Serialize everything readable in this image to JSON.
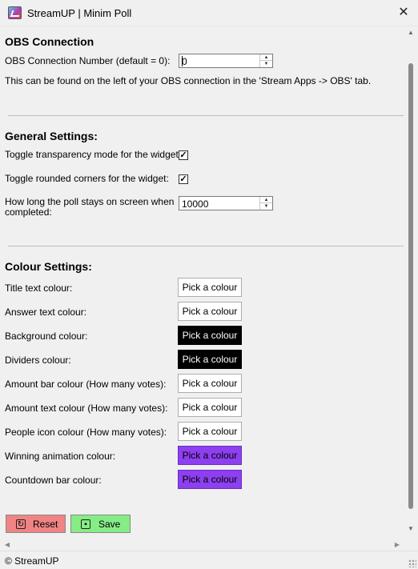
{
  "window": {
    "title": "StreamUP | Minim Poll",
    "close_glyph": "✕",
    "app_icon": "streamup-poll-icon"
  },
  "obs_connection": {
    "heading": "OBS Connection",
    "number_label": "OBS Connection Number (default = 0):",
    "number_value": "0",
    "info": "This can be found on the left of your OBS connection in the 'Stream Apps -> OBS' tab."
  },
  "general_settings": {
    "heading": "General Settings:",
    "transparency_label": "Toggle transparency mode for the widget:",
    "transparency_checked": true,
    "rounded_label": "Toggle rounded corners for the widget:",
    "rounded_checked": true,
    "duration_label_line1": "How long the poll stays on screen when",
    "duration_label_line2": "completed:",
    "duration_value": "10000",
    "check_glyph": "✓"
  },
  "colour_settings": {
    "heading": "Colour Settings:",
    "button_label": "Pick a colour",
    "rows": [
      {
        "label": "Title text colour:",
        "swatch": "#ffffff"
      },
      {
        "label": "Answer text colour:",
        "swatch": "#ffffff"
      },
      {
        "label": "Background colour:",
        "swatch": "#000000"
      },
      {
        "label": "Dividers colour:",
        "swatch": "#000000"
      },
      {
        "label": "Amount bar colour (How many votes):",
        "swatch": "#ffffff"
      },
      {
        "label": "Amount text colour (How many votes):",
        "swatch": "#ffffff"
      },
      {
        "label": "People icon colour (How many votes):",
        "swatch": "#ffffff"
      },
      {
        "label": "Winning animation colour:",
        "swatch": "#8e3ff0"
      },
      {
        "label": "Countdown bar colour:",
        "swatch": "#8e3ff0"
      }
    ]
  },
  "actions": {
    "reset_label": "Reset",
    "reset_color": "#f08484",
    "reset_icon": "reset-icon",
    "save_label": "Save",
    "save_color": "#86ec86",
    "save_icon": "floppy-disk-icon"
  },
  "statusbar": {
    "text": "© StreamUP"
  },
  "scroll": {
    "up": "▲",
    "down": "▼",
    "left": "◀",
    "right": "▶"
  }
}
